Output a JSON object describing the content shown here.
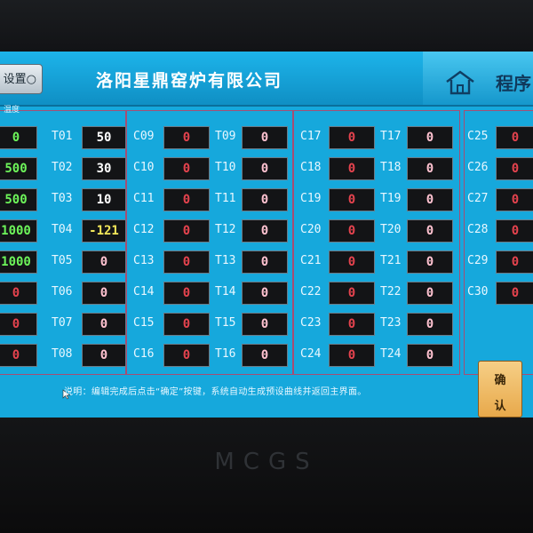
{
  "header": {
    "settings_button": "设置○",
    "title": "洛阳星鼎窑炉有限公司",
    "nav_label": "程序"
  },
  "group1_label": "温度",
  "col0": {
    "values": [
      "0",
      "500",
      "500",
      "1000",
      "1000",
      "0",
      "0",
      "0"
    ],
    "colors": [
      "green",
      "green",
      "green",
      "green",
      "green",
      "red",
      "red",
      "red"
    ]
  },
  "t_col": {
    "labels": [
      "T01",
      "T02",
      "T03",
      "T04",
      "T05",
      "T06",
      "T07",
      "T08"
    ],
    "values": [
      "50",
      "30",
      "10",
      "-121",
      "0",
      "0",
      "0",
      "0"
    ],
    "colors": [
      "white",
      "white",
      "white",
      "yellow",
      "pink",
      "pink",
      "pink",
      "pink"
    ]
  },
  "group2": {
    "c_labels": [
      "C09",
      "C10",
      "C11",
      "C12",
      "C13",
      "C14",
      "C15",
      "C16"
    ],
    "c_values": [
      "0",
      "0",
      "0",
      "0",
      "0",
      "0",
      "0",
      "0"
    ],
    "t_labels": [
      "T09",
      "T10",
      "T11",
      "T12",
      "T13",
      "T14",
      "T15",
      "T16"
    ],
    "t_values": [
      "0",
      "0",
      "0",
      "0",
      "0",
      "0",
      "0",
      "0"
    ]
  },
  "group3": {
    "c_labels": [
      "C17",
      "C18",
      "C19",
      "C20",
      "C21",
      "C22",
      "C23",
      "C24"
    ],
    "c_values": [
      "0",
      "0",
      "0",
      "0",
      "0",
      "0",
      "0",
      "0"
    ],
    "t_labels": [
      "T17",
      "T18",
      "T19",
      "T20",
      "T21",
      "T22",
      "T23",
      "T24"
    ],
    "t_values": [
      "0",
      "0",
      "0",
      "0",
      "0",
      "0",
      "0",
      "0"
    ]
  },
  "group4": {
    "c_labels": [
      "C25",
      "C26",
      "C27",
      "C28",
      "C29",
      "C30"
    ],
    "c_values": [
      "0",
      "0",
      "0",
      "0",
      "0",
      "0"
    ]
  },
  "confirm_button": {
    "line1": "确",
    "line2": "认"
  },
  "note": "说明：编辑完成后点击“确定”按键，系统自动生成预设曲线并返回主界面。",
  "brand": "MCGS",
  "colors": {
    "screen_bg": "#16a8dc",
    "cell_bg": "#131416",
    "value_red": "#e5434e",
    "accent_orange": "#e8a94b"
  },
  "icons": [
    "home-icon",
    "cursor-icon"
  ]
}
